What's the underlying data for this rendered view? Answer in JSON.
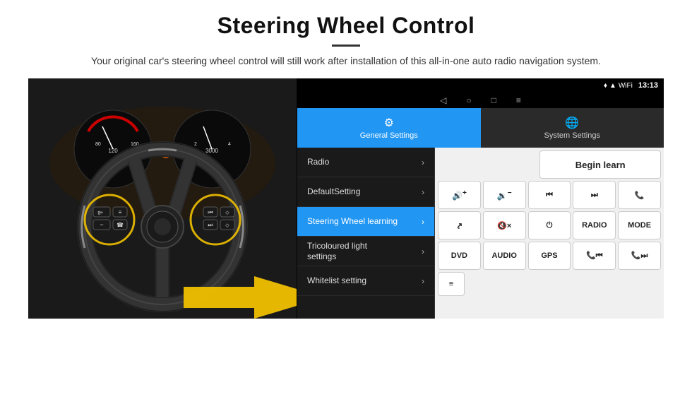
{
  "page": {
    "title": "Steering Wheel Control",
    "subtitle": "Your original car's steering wheel control will still work after installation of this all-in-one auto radio navigation system.",
    "divider": true
  },
  "status_bar": {
    "time": "13:13",
    "icons": [
      "location",
      "signal",
      "wifi"
    ]
  },
  "nav_bar": {
    "buttons": [
      "back",
      "home",
      "recents",
      "menu"
    ]
  },
  "tabs": [
    {
      "id": "general",
      "label": "General Settings",
      "icon": "⚙",
      "active": true
    },
    {
      "id": "system",
      "label": "System Settings",
      "icon": "🌐",
      "active": false
    }
  ],
  "menu_items": [
    {
      "id": "radio",
      "label": "Radio",
      "active": false
    },
    {
      "id": "defaultsetting",
      "label": "DefaultSetting",
      "active": false
    },
    {
      "id": "steering",
      "label": "Steering Wheel learning",
      "active": true
    },
    {
      "id": "tricoloured",
      "label": "Tricoloured light settings",
      "active": false
    },
    {
      "id": "whitelist",
      "label": "Whitelist setting",
      "active": false
    }
  ],
  "button_panel": {
    "begin_learn_label": "Begin learn",
    "rows": [
      {
        "id": "row1",
        "buttons": [
          {
            "id": "vol_up",
            "label": "🔊+",
            "icon": true
          },
          {
            "id": "vol_down",
            "label": "🔉−",
            "icon": true
          },
          {
            "id": "prev_track",
            "label": "⏮",
            "icon": true
          },
          {
            "id": "next_track",
            "label": "⏭",
            "icon": true
          },
          {
            "id": "phone",
            "label": "📞",
            "icon": true
          }
        ]
      },
      {
        "id": "row2",
        "buttons": [
          {
            "id": "hang_up",
            "label": "↩",
            "icon": true
          },
          {
            "id": "mute",
            "label": "🔇×",
            "icon": true
          },
          {
            "id": "power",
            "label": "⏻",
            "icon": true
          },
          {
            "id": "radio_btn",
            "label": "RADIO",
            "icon": false
          },
          {
            "id": "mode_btn",
            "label": "MODE",
            "icon": false
          }
        ]
      },
      {
        "id": "row3",
        "buttons": [
          {
            "id": "dvd_btn",
            "label": "DVD",
            "icon": false
          },
          {
            "id": "audio_btn",
            "label": "AUDIO",
            "icon": false
          },
          {
            "id": "gps_btn",
            "label": "GPS",
            "icon": false
          },
          {
            "id": "phone_prev",
            "label": "📞⏮",
            "icon": true
          },
          {
            "id": "phone_next",
            "label": "📞⏭",
            "icon": true
          }
        ]
      },
      {
        "id": "row4",
        "buttons": [
          {
            "id": "list_btn",
            "label": "≡",
            "icon": true
          }
        ]
      }
    ]
  }
}
